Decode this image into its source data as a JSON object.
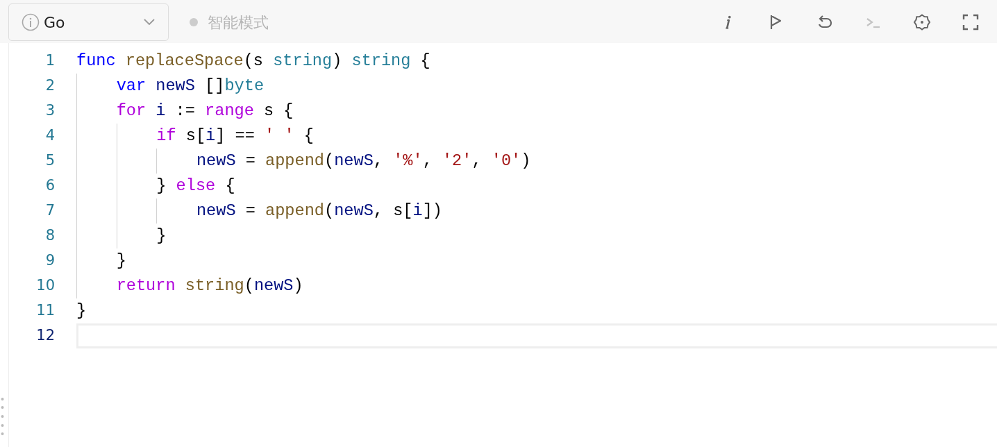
{
  "language_select": {
    "value": "Go"
  },
  "smart_mode": {
    "label": "智能模式",
    "on": false
  },
  "toolbar": [
    {
      "kind": "info",
      "disabled": false
    },
    {
      "kind": "flag",
      "disabled": false
    },
    {
      "kind": "reset",
      "disabled": false
    },
    {
      "kind": "console",
      "disabled": true
    },
    {
      "kind": "settings",
      "disabled": false
    },
    {
      "kind": "fullscreen",
      "disabled": false
    }
  ],
  "editor": {
    "lines": [
      {
        "number": "1",
        "selected": false,
        "tokens": [
          {
            "kind": "kw",
            "text": "func "
          },
          {
            "kind": "fn",
            "text": "replaceSpace"
          },
          {
            "kind": "plain",
            "text": "(s "
          },
          {
            "kind": "type",
            "text": "string"
          },
          {
            "kind": "plain",
            "text": ") "
          },
          {
            "kind": "type",
            "text": "string"
          },
          {
            "kind": "plain",
            "text": " {"
          }
        ]
      },
      {
        "number": "2",
        "selected": false,
        "tokens": [
          {
            "kind": "kw",
            "text": "    var "
          },
          {
            "kind": "var",
            "text": "newS"
          },
          {
            "kind": "plain",
            "text": " []"
          },
          {
            "kind": "type",
            "text": "byte"
          }
        ]
      },
      {
        "number": "3",
        "selected": false,
        "tokens": [
          {
            "kind": "ctrl",
            "text": "    for "
          },
          {
            "kind": "var",
            "text": "i"
          },
          {
            "kind": "plain",
            "text": " := "
          },
          {
            "kind": "ctrl",
            "text": "range"
          },
          {
            "kind": "plain",
            "text": " s {"
          }
        ]
      },
      {
        "number": "4",
        "selected": false,
        "tokens": [
          {
            "kind": "ctrl",
            "text": "        if"
          },
          {
            "kind": "plain",
            "text": " s["
          },
          {
            "kind": "var",
            "text": "i"
          },
          {
            "kind": "plain",
            "text": "] == "
          },
          {
            "kind": "str",
            "text": "' '"
          },
          {
            "kind": "plain",
            "text": " {"
          }
        ]
      },
      {
        "number": "5",
        "selected": false,
        "tokens": [
          {
            "kind": "var",
            "text": "            newS"
          },
          {
            "kind": "plain",
            "text": " = "
          },
          {
            "kind": "fn",
            "text": "append"
          },
          {
            "kind": "plain",
            "text": "("
          },
          {
            "kind": "var",
            "text": "newS"
          },
          {
            "kind": "plain",
            "text": ", "
          },
          {
            "kind": "str",
            "text": "'%'"
          },
          {
            "kind": "plain",
            "text": ", "
          },
          {
            "kind": "str",
            "text": "'2'"
          },
          {
            "kind": "plain",
            "text": ", "
          },
          {
            "kind": "str",
            "text": "'0'"
          },
          {
            "kind": "plain",
            "text": ")"
          }
        ]
      },
      {
        "number": "6",
        "selected": false,
        "tokens": [
          {
            "kind": "plain",
            "text": "        } "
          },
          {
            "kind": "ctrl",
            "text": "else"
          },
          {
            "kind": "plain",
            "text": " {"
          }
        ]
      },
      {
        "number": "7",
        "selected": false,
        "tokens": [
          {
            "kind": "var",
            "text": "            newS"
          },
          {
            "kind": "plain",
            "text": " = "
          },
          {
            "kind": "fn",
            "text": "append"
          },
          {
            "kind": "plain",
            "text": "("
          },
          {
            "kind": "var",
            "text": "newS"
          },
          {
            "kind": "plain",
            "text": ", s["
          },
          {
            "kind": "var",
            "text": "i"
          },
          {
            "kind": "plain",
            "text": "])"
          }
        ]
      },
      {
        "number": "8",
        "selected": false,
        "tokens": [
          {
            "kind": "plain",
            "text": "        }"
          }
        ]
      },
      {
        "number": "9",
        "selected": false,
        "tokens": [
          {
            "kind": "plain",
            "text": "    }"
          }
        ]
      },
      {
        "number": "10",
        "selected": false,
        "tokens": [
          {
            "kind": "ctrl",
            "text": "    return "
          },
          {
            "kind": "fn",
            "text": "string"
          },
          {
            "kind": "plain",
            "text": "("
          },
          {
            "kind": "var",
            "text": "newS"
          },
          {
            "kind": "plain",
            "text": ")"
          }
        ]
      },
      {
        "number": "11",
        "selected": false,
        "tokens": [
          {
            "kind": "plain",
            "text": "}"
          }
        ]
      },
      {
        "number": "12",
        "selected": true
      }
    ]
  }
}
